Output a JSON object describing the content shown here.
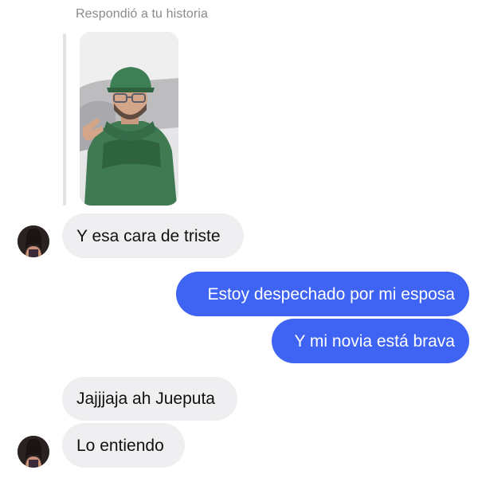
{
  "reply_context": {
    "label": "Respondió a tu historia",
    "story_thumbnail": "story-photo"
  },
  "messages": [
    {
      "direction": "incoming",
      "text": "Y esa cara de triste",
      "show_avatar": true
    },
    {
      "direction": "outgoing",
      "text": "Estoy despechado por mi esposa"
    },
    {
      "direction": "outgoing",
      "text": "Y mi novia está brava"
    },
    {
      "direction": "incoming",
      "text": "Jajjjaja ah Jueputa",
      "show_avatar": false
    },
    {
      "direction": "incoming",
      "text": "Lo entiendo",
      "show_avatar": true
    }
  ],
  "colors": {
    "outgoing_bubble": "#3f63f3",
    "incoming_bubble": "#efeff1",
    "meta_text": "#8a8a8e"
  }
}
